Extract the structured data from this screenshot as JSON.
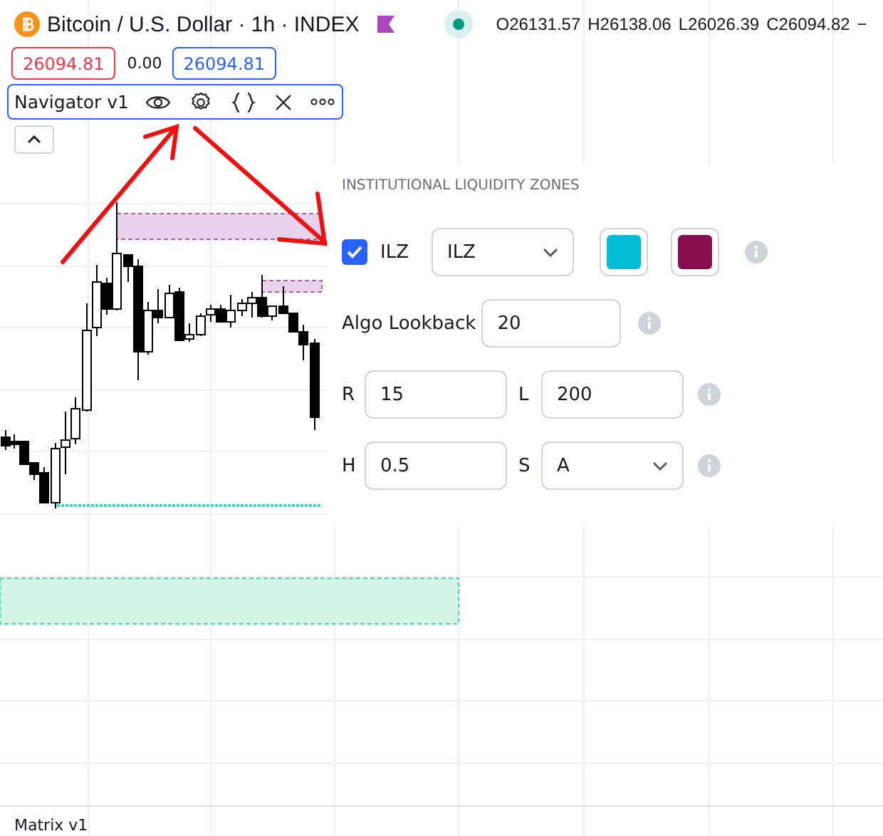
{
  "header": {
    "title": "Bitcoin / U.S. Dollar · 1h · INDEX",
    "market_open": true,
    "ohlc": [
      "O26131.57",
      "H26138.06",
      "L26026.39",
      "C26094.82"
    ],
    "change": "−"
  },
  "trade": {
    "sell": "26094.81",
    "spread": "0.00",
    "buy": "26094.81"
  },
  "legend": {
    "name": "Navigator v1"
  },
  "settings": {
    "title": "INSTITUTIONAL LIQUIDITY ZONES",
    "rows": [
      {
        "kind": "toggle",
        "checked": true,
        "label": "ILZ",
        "select": "ILZ",
        "swatches": [
          {
            "color": "#00bcd4"
          },
          {
            "color": "#880e4f"
          }
        ]
      },
      {
        "kind": "field",
        "label": "Algo Lookback",
        "value": "20"
      },
      {
        "kind": "pair",
        "fields": [
          {
            "label": "R",
            "value": "15"
          },
          {
            "label": "L",
            "value": "200"
          }
        ]
      },
      {
        "kind": "pair",
        "fields": [
          {
            "label": "H",
            "value": "0.5"
          },
          {
            "kind": "select",
            "label": "S",
            "value": "A"
          }
        ]
      }
    ]
  },
  "bottom_pane": {
    "title": "Matrix v1"
  }
}
